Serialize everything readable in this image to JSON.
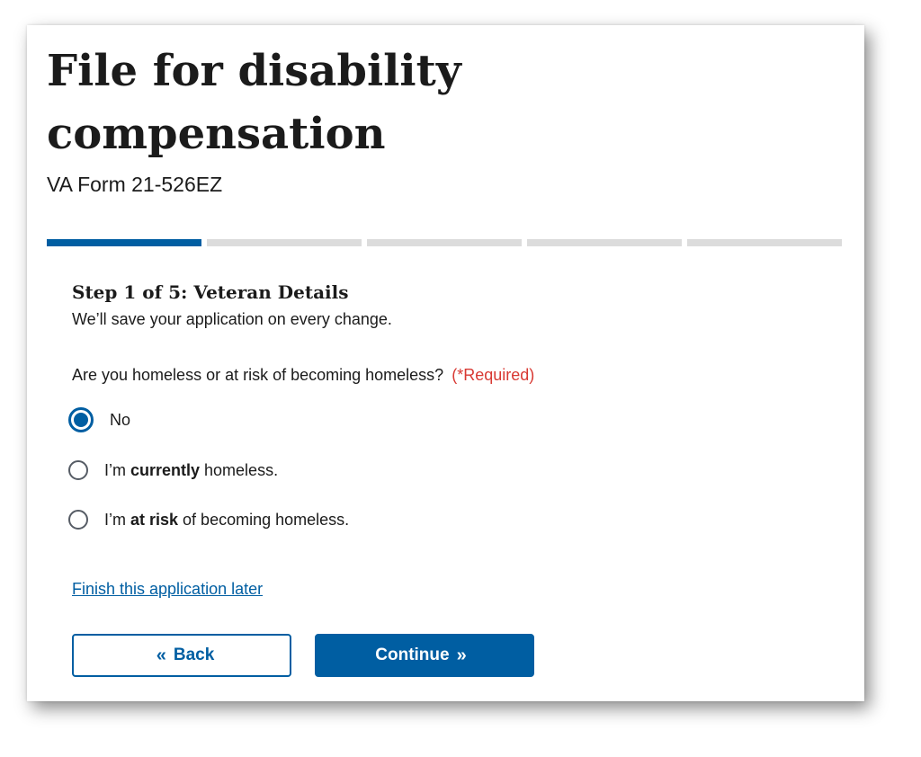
{
  "header": {
    "title": "File for disability compensation",
    "form_number": "VA Form 21-526EZ"
  },
  "progress": {
    "total_steps": 5,
    "current_step": 1
  },
  "step": {
    "title": "Step 1 of 5: Veteran Details",
    "subtitle": "We’ll save your application on every change."
  },
  "question": {
    "label": "Are you homeless or at risk of becoming homeless?",
    "required": "(*Required)"
  },
  "options": [
    {
      "pre": "No",
      "bold": "",
      "post": "",
      "selected": true
    },
    {
      "pre": "I’m ",
      "bold": "currently",
      "post": " homeless.",
      "selected": false
    },
    {
      "pre": "I’m ",
      "bold": "at risk",
      "post": " of becoming homeless.",
      "selected": false
    }
  ],
  "finish_later": "Finish this application later",
  "buttons": {
    "back_icon": "«",
    "back": "Back",
    "continue": "Continue",
    "continue_icon": "»"
  },
  "colors": {
    "primary": "#005ea2",
    "required": "#d83933",
    "progress_inactive": "#dcdcdc"
  }
}
